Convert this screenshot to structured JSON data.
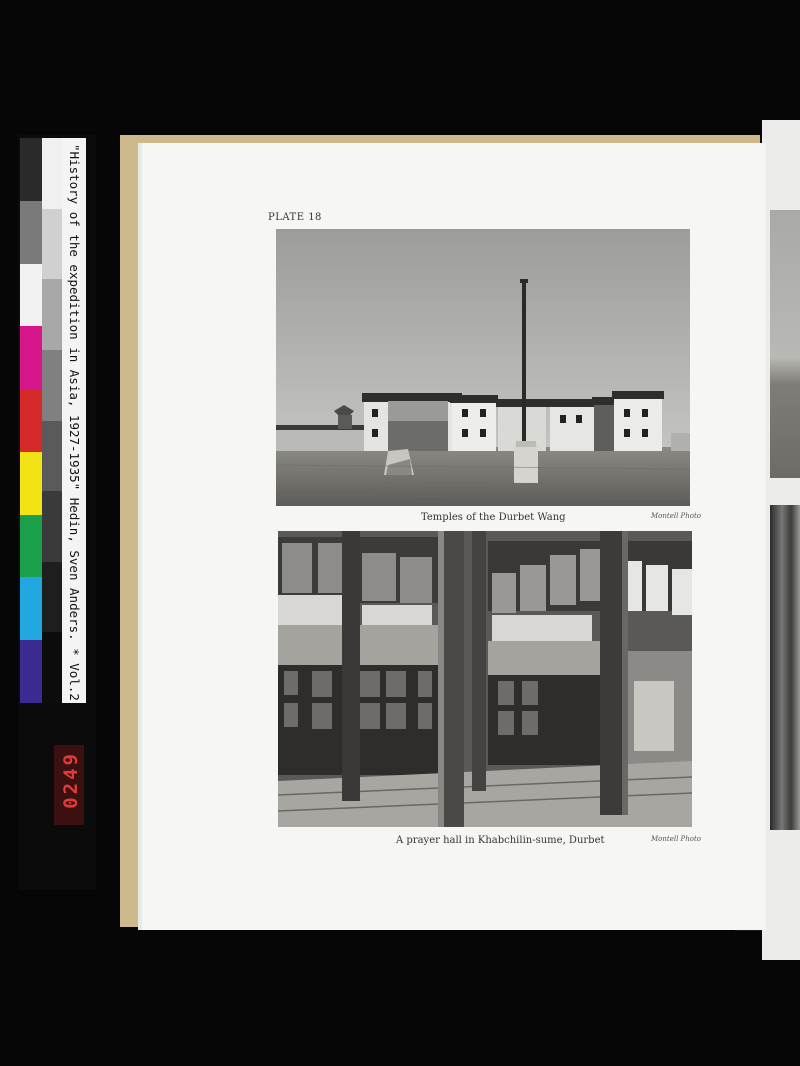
{
  "calibration": {
    "label": "\"History of the expedition in Asia, 1927-1935\" Hedin, Sven Anders. * Vol.2",
    "frame_number": "0249",
    "swatch_colors": [
      "#2a2a2a",
      "#7a7a7a",
      "#f2f2f2",
      "#d8168c",
      "#d62a2a",
      "#f2e414",
      "#1aa04a",
      "#22a8e0",
      "#3a2a92"
    ],
    "gray_steps": [
      "#f0f0f0",
      "#d0d0d0",
      "#a8a8a8",
      "#808080",
      "#5a5a5a",
      "#3a3a3a",
      "#1e1e1e",
      "#0c0c0c"
    ]
  },
  "page": {
    "plate_label": "PLATE 18",
    "photos": [
      {
        "caption": "Temples of the Durbet Wang",
        "credit": "Montell Photo",
        "icon": "temple-photo"
      },
      {
        "caption": "A prayer hall in Khabchilin-sume, Durbet",
        "credit": "Montell Photo",
        "icon": "prayer-hall-photo"
      }
    ]
  }
}
